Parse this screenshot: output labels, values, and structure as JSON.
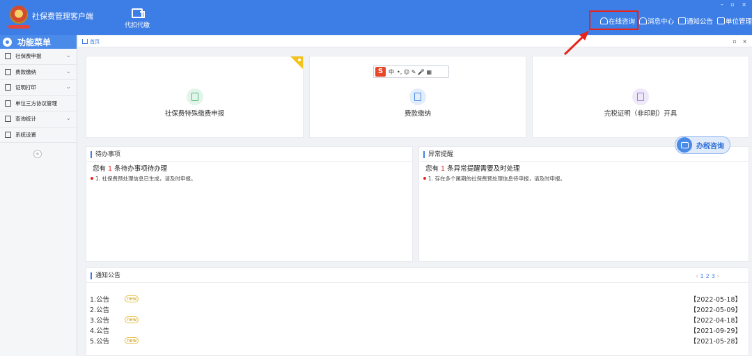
{
  "app": {
    "title": "社保费管理客户端",
    "window_controls": "– ▫ ×"
  },
  "topnav": {
    "daikou_label": "代扣代缴"
  },
  "top_actions": [
    {
      "label": "在线咨询",
      "icon": "headset-icon"
    },
    {
      "label": "消息中心",
      "icon": "bell-icon"
    },
    {
      "label": "通知公告",
      "icon": "envelope-icon"
    },
    {
      "label": "单位管理",
      "icon": "building-icon"
    }
  ],
  "sidebar": {
    "title": "功能菜单",
    "items": [
      {
        "label": "社保费申报",
        "has_arrow": true
      },
      {
        "label": "费款缴纳",
        "has_arrow": true
      },
      {
        "label": "证明打印",
        "has_arrow": true
      },
      {
        "label": "单位三方协议管理",
        "has_arrow": false
      },
      {
        "label": "查询统计",
        "has_arrow": true
      },
      {
        "label": "系统设置",
        "has_arrow": false
      }
    ],
    "collapse": "«"
  },
  "breadcrumb": {
    "home": "首页",
    "controls": "▫ ×"
  },
  "tiles": [
    {
      "label": "社保费特殊缴费申报",
      "color": "#4dbb7b",
      "bg": "#e3f5ea"
    },
    {
      "label": "费款缴纳",
      "color": "#4a8ae8",
      "bg": "#e3edfb"
    },
    {
      "label": "完税证明（非印刷）开具",
      "color": "#9a7fd1",
      "bg": "#eee8f8"
    }
  ],
  "ime": {
    "logo": "S",
    "lang": "中",
    "symbols": "•, ☺ ✎ 🎤 ▦"
  },
  "todo": {
    "title": "待办事项",
    "summary_prefix": "您有",
    "count": "1",
    "summary_suffix": "条待办事项待办理",
    "item": "1. 社保费预处理信息已生成，请及时申报。"
  },
  "alert": {
    "title": "异常提醒",
    "summary_prefix": "您有",
    "count": "1",
    "summary_suffix": "条异常提醒需要及时处理",
    "item": "1. 存在多个属期的社保费预处理信息待申报，请及时申报。"
  },
  "tax_consult": {
    "label": "办税咨询"
  },
  "notices": {
    "title": "通知公告",
    "pager": {
      "prev": "‹",
      "pages": [
        "1",
        "2",
        "3"
      ],
      "next": "›"
    },
    "items": [
      {
        "label": "1.公告",
        "new": true,
        "date": "【2022-05-18】"
      },
      {
        "label": "2.公告",
        "new": false,
        "date": "【2022-05-09】"
      },
      {
        "label": "3.公告",
        "new": true,
        "date": "【2022-04-18】"
      },
      {
        "label": "4.公告",
        "new": false,
        "date": "【2021-09-29】"
      },
      {
        "label": "5.公告",
        "new": true,
        "date": "【2021-05-28】"
      }
    ],
    "new_badge": "new"
  },
  "colors": {
    "accent": "#3d7ee6",
    "highlight": "#e8231b"
  }
}
